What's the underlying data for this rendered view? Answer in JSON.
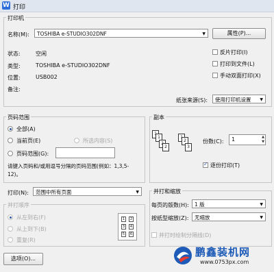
{
  "window": {
    "title": "打印",
    "icon": "wps-icon"
  },
  "printer": {
    "group_title": "打印机",
    "name_label": "名称(M):",
    "name_value": "TOSHIBA e-STUDIO302DNF",
    "properties_button": "属性(P)...",
    "status_label": "状态:",
    "status_value": "空闲",
    "type_label": "类型:",
    "type_value": "TOSHIBA e-STUDIO302DNF",
    "location_label": "位置:",
    "location_value": "USB002",
    "comment_label": "备注:",
    "comment_value": "",
    "reverse_print": "反片打印(I)",
    "print_to_file": "打印到文件(L)",
    "manual_duplex": "手动双面打印(X)",
    "paper_source_label": "纸张来源(S):",
    "paper_source_value": "使用打印机设置"
  },
  "page_range": {
    "group_title": "页码范围",
    "all": "全部(A)",
    "current_page": "当前页(E)",
    "selection": "所选内容(S)",
    "pages": "页码范围(G):",
    "pages_value": "",
    "hint": "请键入页码和/或用逗号分隔的页码范围(例如：1,3,5-12)。"
  },
  "copies": {
    "group_title": "副本",
    "copies_label": "份数(C):",
    "copies_value": "1",
    "collate": "逐份打印(T)",
    "collate_checked": true
  },
  "print_what": {
    "label": "打印(N):",
    "value": "范围中所有页面"
  },
  "print_order": {
    "group_title": "并打顺序",
    "left_to_right": "从左到右(F)",
    "top_to_bottom": "从上到下(B)",
    "repeat": "重复(R)",
    "thumbs": [
      "1",
      "2",
      "3",
      "4",
      "5",
      "6"
    ]
  },
  "scaling": {
    "group_title": "并打和缩放",
    "pages_per_sheet_label": "每页的版数(H):",
    "pages_per_sheet_value": "1 版",
    "scale_label": "按纸型缩放(Z):",
    "scale_value": "无缩放",
    "draw_lines": "并打时绘制分隔线(D)"
  },
  "footer": {
    "options_button": "选项(O)..."
  },
  "watermark": {
    "brand": "鹏鑫装机网",
    "url": "www.0753px.com"
  },
  "icons": {
    "dropdown": "chevron-down-icon",
    "spinner": "spinner-icon"
  }
}
